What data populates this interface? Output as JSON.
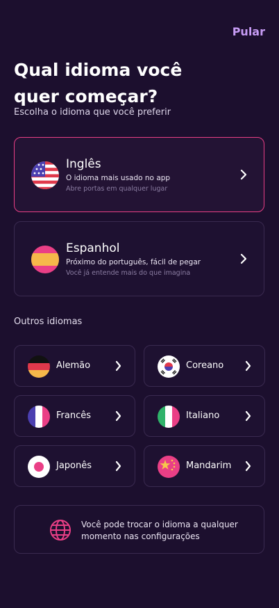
{
  "header": {
    "skip_label": "Pular"
  },
  "title": "Qual idioma você quer começar?",
  "subtitle": "Escolha o idioma que você preferir",
  "featured": [
    {
      "name": "Inglês",
      "description": "O idioma mais usado no app",
      "hint": "Abre portas em qualquer lugar",
      "flag": "usa-flag-icon",
      "selected": true
    },
    {
      "name": "Espanhol",
      "description": "Próximo do português, fácil de pegar",
      "hint": "Você já entende mais do que imagina",
      "flag": "spain-flag-icon",
      "selected": false
    }
  ],
  "others_label": "Outros idiomas",
  "others": [
    {
      "name": "Alemão",
      "flag": "germany-flag-icon"
    },
    {
      "name": "Coreano",
      "flag": "korea-flag-icon"
    },
    {
      "name": "Francês",
      "flag": "france-flag-icon"
    },
    {
      "name": "Italiano",
      "flag": "italy-flag-icon"
    },
    {
      "name": "Japonês",
      "flag": "japan-flag-icon"
    },
    {
      "name": "Mandarim",
      "flag": "china-flag-icon"
    }
  ],
  "info": {
    "text": "Você pode trocar o idioma a qualquer momento nas configurações",
    "icon": "globe-icon"
  },
  "colors": {
    "background": "#1c0f2e",
    "accent_pink": "#ea3f86",
    "skip_purple": "#c79cf5",
    "card_border": "#3a2a50"
  }
}
